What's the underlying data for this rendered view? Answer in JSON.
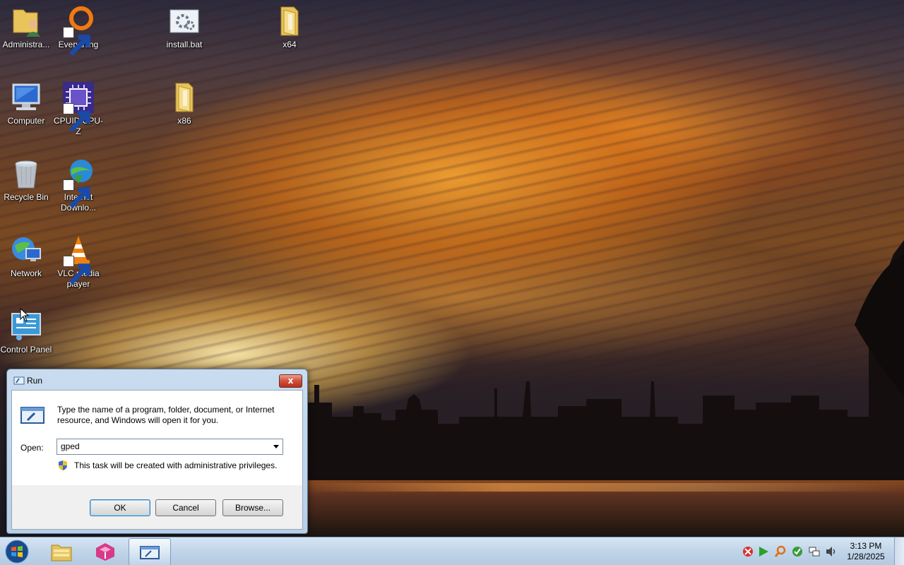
{
  "desktop": {
    "icons": [
      {
        "label": "Administra...",
        "icon": "user-folder-icon"
      },
      {
        "label": "Everything",
        "icon": "everything-search-icon",
        "shortcut": true
      },
      {
        "label": "install.bat",
        "icon": "batch-file-icon"
      },
      {
        "label": "x64",
        "icon": "folder-icon"
      },
      {
        "label": "Computer",
        "icon": "computer-icon"
      },
      {
        "label": "CPUID CPU-Z",
        "icon": "cpuz-icon",
        "shortcut": true
      },
      {
        "label": "x86",
        "icon": "folder-icon"
      },
      {
        "label": "Recycle Bin",
        "icon": "recycle-bin-icon"
      },
      {
        "label": "Internet Downlo...",
        "icon": "idm-icon",
        "shortcut": true
      },
      {
        "label": "Network",
        "icon": "network-icon"
      },
      {
        "label": "VLC media player",
        "icon": "vlc-icon",
        "shortcut": true
      },
      {
        "label": "Control Panel",
        "icon": "control-panel-icon"
      }
    ]
  },
  "run_dialog": {
    "title": "Run",
    "description": "Type the name of a program, folder, document, or Internet resource, and Windows will open it for you.",
    "open_label": "Open:",
    "open_value": "gped",
    "admin_note": "This task will be created with administrative privileges.",
    "ok_label": "OK",
    "cancel_label": "Cancel",
    "browse_label": "Browse...",
    "close_glyph": "x"
  },
  "taskbar": {
    "pinned": [
      {
        "icon": "start-orb-icon"
      },
      {
        "icon": "file-explorer-icon"
      },
      {
        "icon": "app-cube-icon"
      },
      {
        "icon": "run-window-icon",
        "active": true
      }
    ],
    "tray_icons": [
      "network-disconnected-icon",
      "media-play-icon",
      "search-tool-icon",
      "security-check-icon",
      "network-icon",
      "volume-icon"
    ],
    "clock_time": "3:13 PM",
    "clock_date": "1/28/2025"
  }
}
